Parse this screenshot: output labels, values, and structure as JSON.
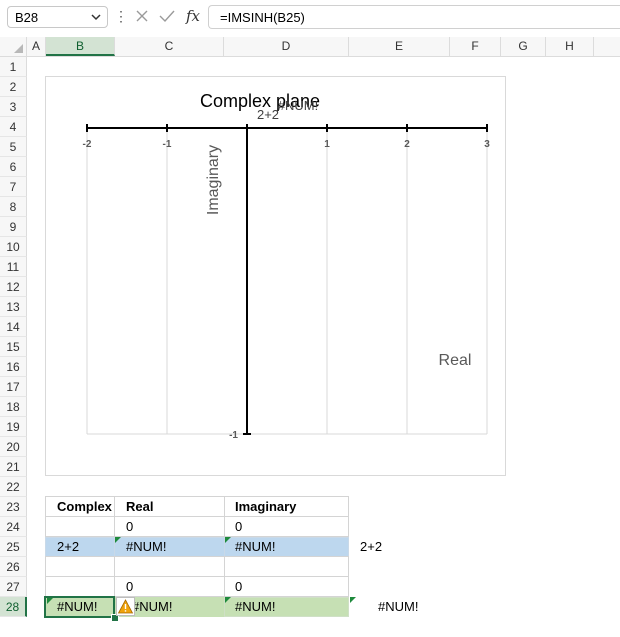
{
  "formula_bar": {
    "name_box": "B28",
    "formula": "=IMSINH(B25)",
    "fx_label": "fx",
    "cancel_icon": "close-icon",
    "enter_icon": "checkmark-icon"
  },
  "columns": [
    "A",
    "B",
    "C",
    "D",
    "E",
    "F",
    "G",
    "H"
  ],
  "rows": [
    "1",
    "2",
    "3",
    "4",
    "5",
    "6",
    "7",
    "8",
    "9",
    "10",
    "11",
    "12",
    "13",
    "14",
    "15",
    "16",
    "17",
    "18",
    "19",
    "20",
    "21",
    "22",
    "23",
    "24",
    "25",
    "26",
    "27",
    "28"
  ],
  "chart": {
    "title": "Complex plane",
    "ylabel": "Imaginary",
    "xlabel": "Real",
    "data_label_value": "#NUM!",
    "data_label_name": "2+2",
    "x_ticks": [
      "-2",
      "-1",
      "1",
      "2",
      "3"
    ],
    "y_tick": "-1"
  },
  "chart_data": {
    "type": "scatter",
    "title": "Complex plane",
    "xlabel": "Real",
    "ylabel": "Imaginary",
    "xlim": [
      -2,
      3
    ],
    "ylim": [
      -1,
      0
    ],
    "x_ticks": [
      -2,
      -1,
      1,
      2,
      3
    ],
    "y_ticks": [
      -1
    ],
    "grid": true,
    "annotations": [
      "#NUM!",
      "2+2"
    ]
  },
  "table": {
    "headers": {
      "complex": "Complex",
      "real": "Real",
      "imaginary": "Imaginary"
    },
    "row24": {
      "real": "0",
      "imaginary": "0"
    },
    "row25": {
      "complex": "2+2",
      "real": "#NUM!",
      "imaginary": "#NUM!",
      "side": "2+2"
    },
    "row27": {
      "real": "0",
      "imaginary": "0"
    },
    "row28": {
      "complex": "#NUM!",
      "real": "#NUM!",
      "imaginary": "#NUM!",
      "side": "#NUM!"
    }
  },
  "colors": {
    "accent": "#217346",
    "row25_fill": "#bdd7ee",
    "row28_fill": "#c6e0b4",
    "warning": "#f0a30a"
  }
}
